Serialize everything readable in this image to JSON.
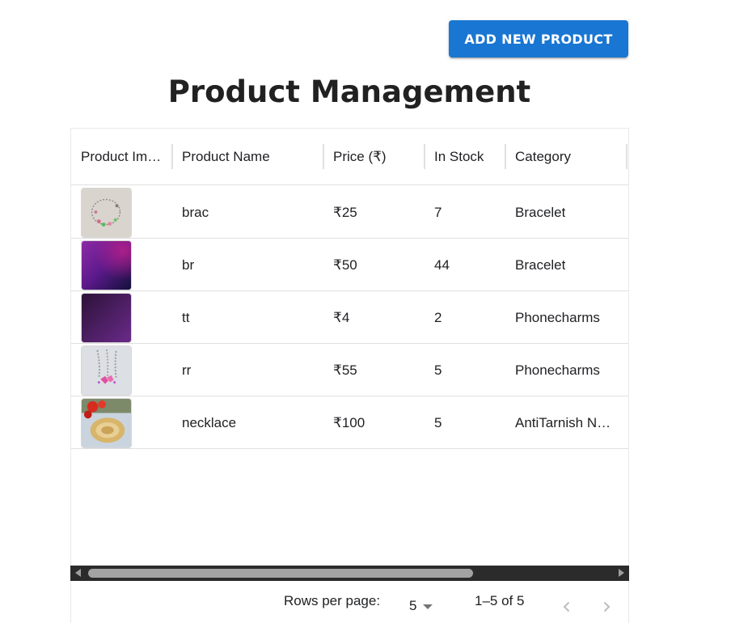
{
  "toolbar": {
    "add_label": "ADD NEW PRODUCT"
  },
  "page": {
    "title": "Product Management"
  },
  "table": {
    "columns": [
      "Product Im…",
      "Product Name",
      "Price (₹)",
      "In Stock",
      "Category"
    ],
    "rows": [
      {
        "image": "bracelet-photo",
        "name": "brac",
        "price": "₹25",
        "stock": "7",
        "category": "Bracelet"
      },
      {
        "image": "purple-gradient-image",
        "name": "br",
        "price": "₹50",
        "stock": "44",
        "category": "Bracelet"
      },
      {
        "image": "dark-purple-image",
        "name": "tt",
        "price": "₹4",
        "stock": "2",
        "category": "Phonecharms"
      },
      {
        "image": "phonecharm-photo",
        "name": "rr",
        "price": "₹55",
        "stock": "5",
        "category": "Phonecharms"
      },
      {
        "image": "necklace-photo",
        "name": "necklace",
        "price": "₹100",
        "stock": "5",
        "category": "AntiTarnish N…"
      }
    ]
  },
  "pagination": {
    "rows_per_page_label": "Rows per page:",
    "rows_per_page_value": "5",
    "displayed_rows": "1–5 of 5",
    "prev_icon": "chevron-left-icon",
    "next_icon": "chevron-right-icon"
  },
  "colors": {
    "primary": "#1976d2",
    "text": "#202124",
    "divider": "#e0e0e0"
  }
}
